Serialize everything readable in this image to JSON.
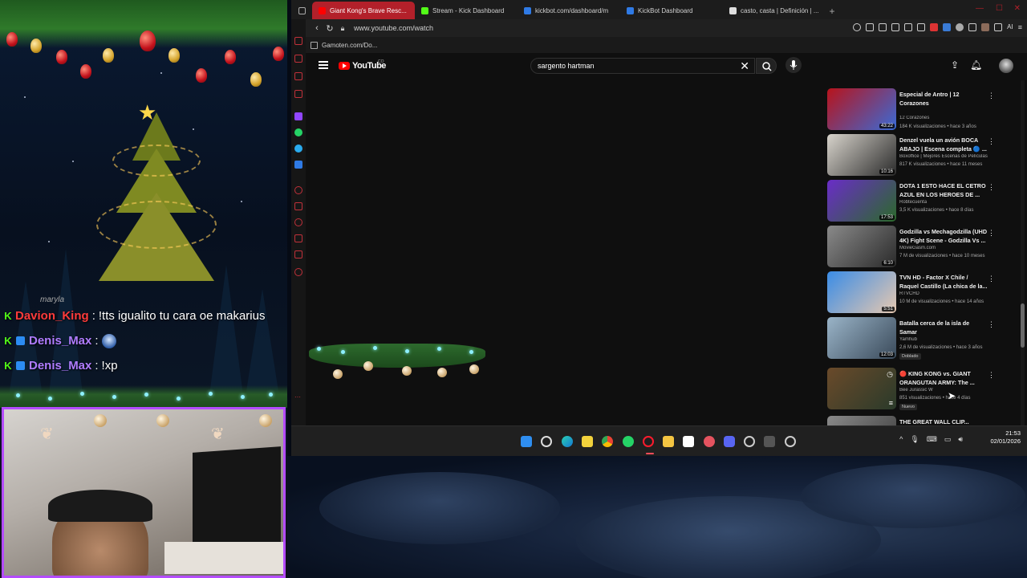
{
  "overlay": {
    "tree_caption": "maryla",
    "chat": [
      {
        "user": "Davion_King",
        "user_color": "#ff3b3b",
        "message": "!tts igualito tu cara oe makarius",
        "emote": false
      },
      {
        "user": "Denis_Max",
        "user_color": "#b07cff",
        "message": "",
        "emote": true
      },
      {
        "user": "Denis_Max",
        "user_color": "#b07cff",
        "message": "!xp",
        "emote": false
      }
    ]
  },
  "browser": {
    "tabs": [
      {
        "title": "Giant Kong's Brave Resc...",
        "favicon": "youtube-icon",
        "active": true
      },
      {
        "title": "Stream - Kick Dashboard",
        "favicon": "kick-icon",
        "active": false
      },
      {
        "title": "kickbot.com/dashboard/m",
        "favicon": "kickbot-icon",
        "active": false
      },
      {
        "title": "KickBot Dashboard",
        "favicon": "kickbot-icon",
        "active": false
      },
      {
        "title": "casto, casta | Definición | ...",
        "favicon": "rae-icon",
        "active": false
      }
    ],
    "new_tab": "+",
    "url": "www.youtube.com/watch",
    "bookmark": "Gamoten.com/Do...",
    "ext_ai_label": "AI"
  },
  "youtube": {
    "logo_text": "YouTube",
    "country": "CO",
    "search_value": "sargento hartman",
    "search_clear": "✕",
    "related": [
      {
        "title": "Especial de Antro | 12 Corazones",
        "channel": "12 Corazones",
        "meta": "184 K visualizaciones • hace 3 años",
        "duration": "43:22",
        "badge": "",
        "thumb": [
          "#b8131b",
          "#3a6bd6"
        ]
      },
      {
        "title": "Denzel vuela un avión BOCA ABAJO | Escena completa 🔵 ...",
        "channel": "Boxoffice | Mejores Escenas de Películas",
        "meta": "817 K visualizaciones • hace 11 meses",
        "duration": "10:16",
        "badge": "",
        "thumb": [
          "#d8d4cc",
          "#2a2a2a"
        ]
      },
      {
        "title": "DOTA 1 ESTO HACE EL CETRO AZUL EN LOS HEROES DE ...",
        "channel": "Robtecuenta",
        "meta": "3,5 K visualizaciones • hace 8 días",
        "duration": "17:53",
        "badge": "",
        "thumb": [
          "#6a2cc8",
          "#2b6a2a"
        ]
      },
      {
        "title": "Godzilla vs Mechagodzilla (UHD 4K) Fight Scene - Godzilla Vs ...",
        "channel": "MovieGasm.com",
        "meta": "7 M de visualizaciones • hace 10 meses",
        "duration": "6:10",
        "badge": "",
        "thumb": [
          "#6a6a6a",
          "#2a2a2a"
        ]
      },
      {
        "title": "TVN HD - Factor X Chile / Raquel Castillo (La chica de la...",
        "channel": "RTVCHD",
        "meta": "10 M de visualizaciones • hace 14 años",
        "duration": "5:51",
        "badge": "",
        "thumb": [
          "#3a8ce6",
          "#e6c8b0"
        ]
      },
      {
        "title": "Batalla cerca de la isla de Samar",
        "channel": "Yamhub",
        "meta": "2,6 M de visualizaciones • hace 3 años",
        "duration": "12:03",
        "badge": "Doblado",
        "thumb": [
          "#9ab4c8",
          "#3a4a5a"
        ]
      },
      {
        "title": "🔴 KING KONG vs. GIANT ORANGUTAN ARMY: The ...",
        "channel": "Bee Jurassic W",
        "meta": "851 visualizaciones • hace 4 días",
        "duration": "",
        "badge": "Nuevo",
        "thumb": [
          "#6a4a2a",
          "#2a3a2a"
        ]
      },
      {
        "title": "THE GREAT WALL CLIP...",
        "channel": "",
        "meta": "",
        "duration": "",
        "badge": "",
        "thumb": [
          "#8a8a8a",
          "#3a3a3a"
        ]
      }
    ]
  },
  "taskbar": {
    "clock_time": "21:53",
    "clock_date": "02/01/2026",
    "tray_chevron": "^"
  }
}
